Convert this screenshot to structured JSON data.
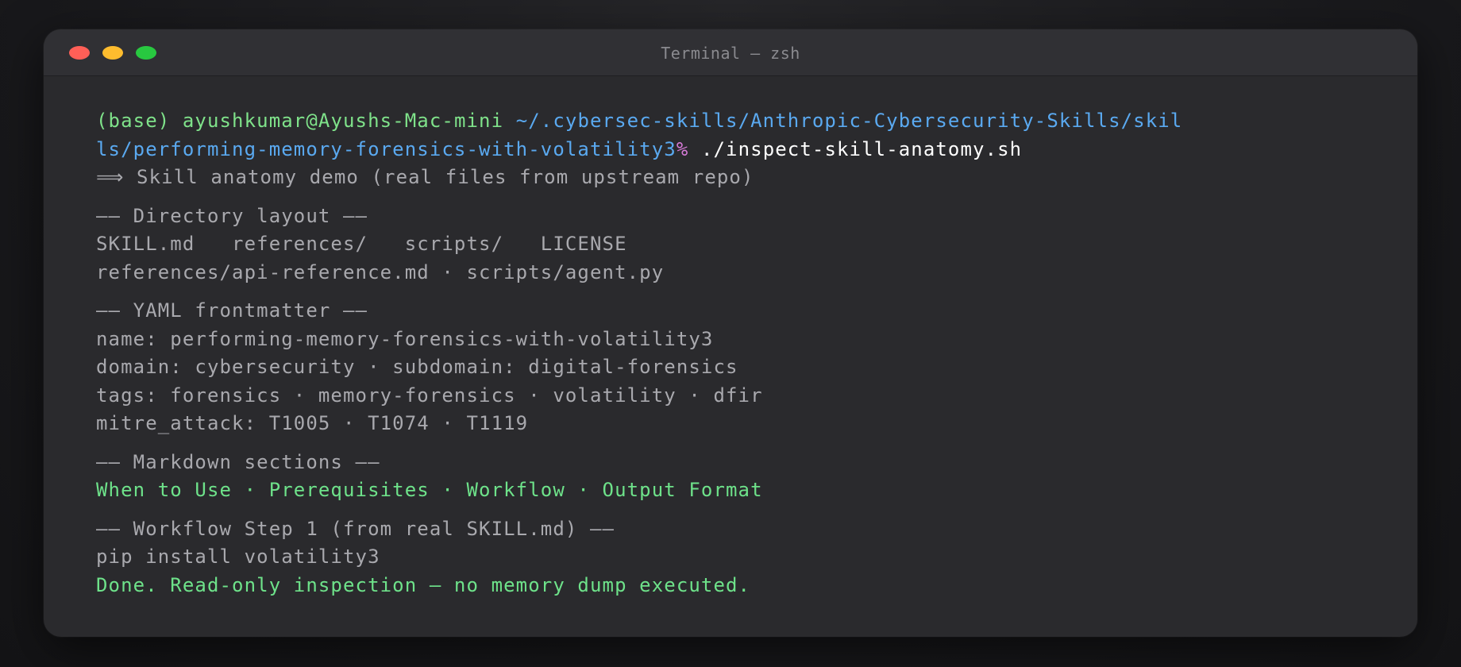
{
  "window": {
    "title": "Terminal — zsh"
  },
  "prompt": {
    "env": "(base)",
    "user_host": "ayushkumar@Ayushs-Mac-mini",
    "path_line1": "~/.cybersec-skills/Anthropic-Cybersecurity-Skills/skil",
    "path_line2": "ls/performing-memory-forensics-with-volatility3",
    "symbol": "%",
    "command": "./inspect-skill-anatomy.sh"
  },
  "output": {
    "intro": "⟹ Skill anatomy demo (real files from upstream repo)",
    "dir_header": "—— Directory layout ——",
    "dir_line1": "SKILL.md   references/   scripts/   LICENSE",
    "dir_line2": "references/api-reference.md · scripts/agent.py",
    "yaml_header": "—— YAML frontmatter ——",
    "yaml_name": "name: performing-memory-forensics-with-volatility3",
    "yaml_domain": "domain: cybersecurity · subdomain: digital-forensics",
    "yaml_tags": "tags: forensics · memory-forensics · volatility · dfir",
    "yaml_mitre": "mitre_attack: T1005 · T1074 · T1119",
    "md_header": "—— Markdown sections ——",
    "md_sections": "When to Use · Prerequisites · Workflow · Output Format",
    "step_header": "—— Workflow Step 1 (from real SKILL.md) ——",
    "step_cmd": "pip install volatility3",
    "done": "Done. Read-only inspection — no memory dump executed."
  },
  "colors": {
    "prompt_green": "#7fe28a",
    "path_blue": "#5aa9f0",
    "prompt_symbol": "#d67bd8",
    "success_green": "#6ee28a",
    "output_gray": "#a9a9ae"
  }
}
